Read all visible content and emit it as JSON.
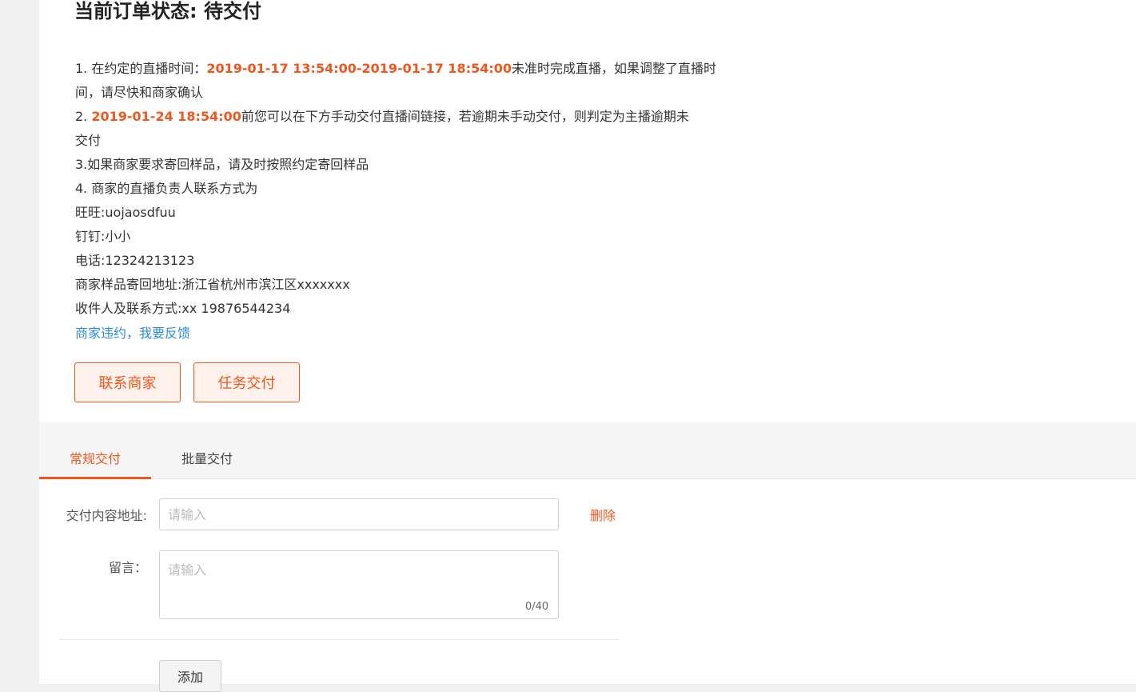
{
  "order": {
    "status_title": "当前订单状态: 待交付"
  },
  "notes": {
    "line1_prefix": "1. 在约定的直播时间：",
    "line1_time": "2019-01-17 13:54:00-2019-01-17 18:54:00",
    "line1_suffix": "未准时完成直播，如果调整了直播时",
    "line1_cont": "间，请尽快和商家确认",
    "line2_prefix": "2. ",
    "line2_time": "2019-01-24 18:54:00",
    "line2_suffix": "前您可以在下方手动交付直播间链接，若逾期未手动交付，则判定为主播逾期未",
    "line2_cont": "交付",
    "line3": "3.如果商家要求寄回样品，请及时按照约定寄回样品",
    "line4": "4. 商家的直播负责人联系方式为",
    "wangwang": "旺旺:uojaosdfuu",
    "dingding": "钉钉:小小",
    "phone": "电话:12324213123",
    "return_address": "商家样品寄回地址:浙江省杭州市滨江区xxxxxxx",
    "recipient": "收件人及联系方式:xx 19876544234",
    "feedback_link": "商家违约，我要反馈"
  },
  "actions": {
    "contact_label": "联系商家",
    "deliver_label": "任务交付"
  },
  "tabs": [
    {
      "label": "常规交付",
      "active": true
    },
    {
      "label": "批量交付",
      "active": false
    }
  ],
  "form": {
    "url_label": "交付内容地址:",
    "url_placeholder": "请输入",
    "url_value": "",
    "delete_label": "删除",
    "message_label": "留言：",
    "message_placeholder": "请输入",
    "message_value": "",
    "counter": "0/40",
    "add_label": "添加"
  },
  "colors": {
    "accent": "#f2561d",
    "link": "#2e8bd8"
  }
}
